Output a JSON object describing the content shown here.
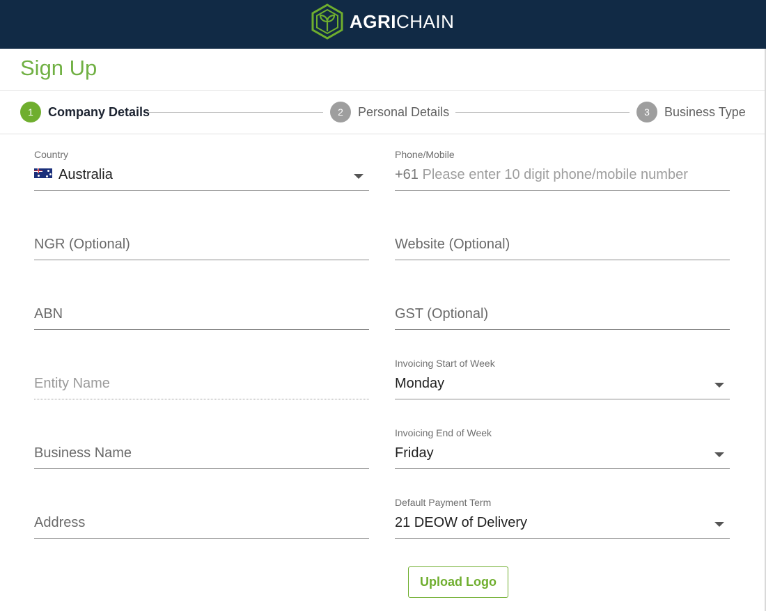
{
  "brand": {
    "part1": "AGRI",
    "part2": "CHAIN"
  },
  "page_title": "Sign Up",
  "steps": [
    {
      "number": "1",
      "label": "Company Details",
      "state": "active"
    },
    {
      "number": "2",
      "label": "Personal Details",
      "state": "inactive"
    },
    {
      "number": "3",
      "label": "Business Type",
      "state": "inactive"
    }
  ],
  "form": {
    "country": {
      "label": "Country",
      "value": "Australia",
      "flag_icon": "australia-flag-icon"
    },
    "phone": {
      "label": "Phone/Mobile",
      "prefix": "+61",
      "placeholder": "Please enter 10 digit phone/mobile number"
    },
    "ngr": {
      "placeholder": "NGR (Optional)"
    },
    "website": {
      "placeholder": "Website (Optional)"
    },
    "abn": {
      "placeholder": "ABN"
    },
    "gst": {
      "placeholder": "GST (Optional)"
    },
    "entity_name": {
      "placeholder": "Entity Name"
    },
    "invoice_start": {
      "label": "Invoicing Start of Week",
      "value": "Monday"
    },
    "business_name": {
      "placeholder": "Business Name"
    },
    "invoice_end": {
      "label": "Invoicing End of Week",
      "value": "Friday"
    },
    "address": {
      "placeholder": "Address"
    },
    "payment_term": {
      "label": "Default Payment Term",
      "value": "21 DEOW of Delivery"
    }
  },
  "upload_button": {
    "label": "Upload Logo"
  },
  "colors": {
    "header_bg": "#112a45",
    "accent": "#6fae2e",
    "inactive_step": "#9e9e9e"
  }
}
